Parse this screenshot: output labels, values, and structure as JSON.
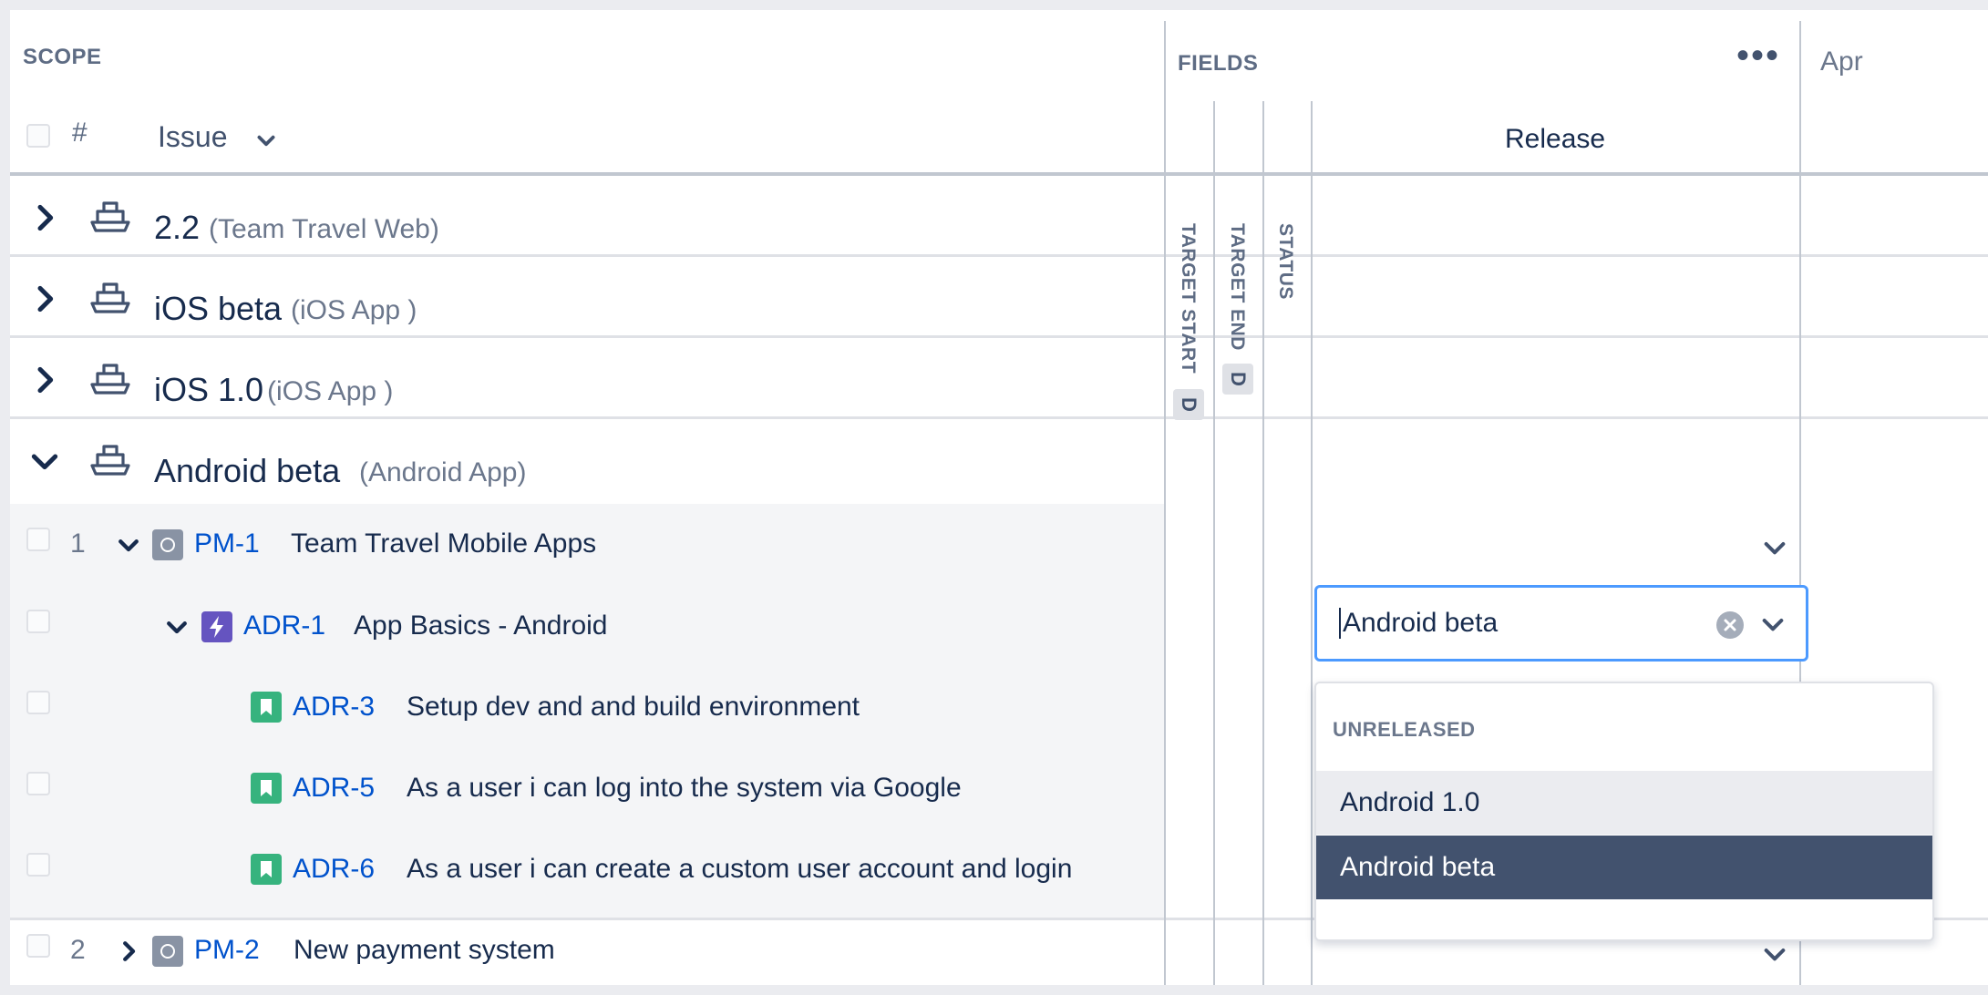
{
  "header": {
    "scope_title": "SCOPE",
    "fields_title": "FIELDS",
    "hash_label": "#",
    "issue_column": "Issue",
    "release_column": "Release",
    "timeline_month": "Apr"
  },
  "vertical_fields": [
    {
      "label": "TARGET START",
      "badge": "D"
    },
    {
      "label": "TARGET END",
      "badge": "D"
    },
    {
      "label": "STATUS",
      "badge": ""
    }
  ],
  "releases": [
    {
      "name": "2.2",
      "team": "(Team Travel Web)",
      "expanded": false
    },
    {
      "name": "iOS beta",
      "team": "(iOS App )",
      "expanded": false
    },
    {
      "name": "iOS 1.0",
      "team": "(iOS App )",
      "expanded": false
    },
    {
      "name": "Android beta",
      "team": "(Android App)",
      "expanded": true
    }
  ],
  "issues": [
    {
      "num": "1",
      "key": "PM-1",
      "title": "Team Travel Mobile Apps",
      "type": "initiative",
      "expanded": true
    },
    {
      "num": "",
      "key": "ADR-1",
      "title": "App Basics - Android",
      "type": "epic",
      "expanded": true
    },
    {
      "num": "",
      "key": "ADR-3",
      "title": "Setup dev and and build environment",
      "type": "story"
    },
    {
      "num": "",
      "key": "ADR-5",
      "title": "As a user i can log into the system via Google",
      "type": "story"
    },
    {
      "num": "",
      "key": "ADR-6",
      "title": "As a user i can create a custom user account and login",
      "type": "story"
    },
    {
      "num": "2",
      "key": "PM-2",
      "title": "New payment system",
      "type": "initiative",
      "expanded": false
    }
  ],
  "release_select": {
    "value": "Android beta",
    "group_label": "UNRELEASED",
    "options": [
      "Android 1.0",
      "Android beta"
    ],
    "hovered": "Android 1.0",
    "selected": "Android beta"
  },
  "colors": {
    "link": "#0052cc",
    "epic": "#6554c0",
    "story": "#36b37e",
    "initiative": "#8993a4",
    "focus": "#4c9aff",
    "selected_bg": "#42526e"
  }
}
